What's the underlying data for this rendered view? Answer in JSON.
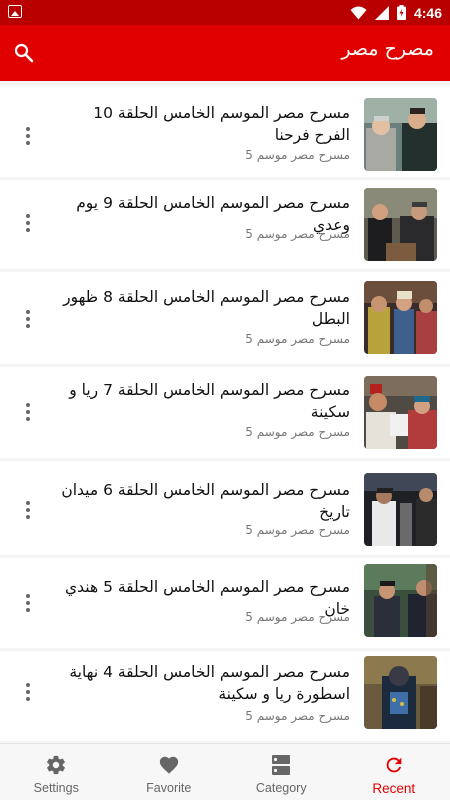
{
  "status_bar": {
    "time": "4:46"
  },
  "app_bar": {
    "title": "مصرح مصر",
    "search_icon": "search-icon"
  },
  "colors": {
    "primary": "#e00000",
    "status_bar": "#b80000",
    "active": "#e00000"
  },
  "episodes": [
    {
      "title": "مسرح مصر الموسم الخامس الحلقة 10 الفرح فرحنا",
      "subtitle": "مسرح مصر موسم 5"
    },
    {
      "title": "مسرح مصر الموسم الخامس الحلقة 9 يوم وعدي",
      "subtitle": "مسرح مصر موسم 5"
    },
    {
      "title": "مسرح مصر الموسم الخامس الحلقة 8 ظهور البطل",
      "subtitle": "مسرح مصر موسم 5"
    },
    {
      "title": "مسرح مصر الموسم الخامس الحلقة 7 ريا و سكينة",
      "subtitle": "مسرح مصر موسم 5"
    },
    {
      "title": "مسرح مصر الموسم الخامس الحلقة 6 ميدان تاريخ",
      "subtitle": "مسرح مصر موسم 5"
    },
    {
      "title": "مسرح مصر الموسم الخامس الحلقة 5 هندي خان",
      "subtitle": "مسرح مصر موسم 5"
    },
    {
      "title": "مسرح مصر الموسم الخامس الحلقة 4 نهاية اسطورة ريا و سكينة",
      "subtitle": "مسرح مصر موسم 5"
    }
  ],
  "bottom_nav": [
    {
      "label": "Settings",
      "icon": "gear-icon"
    },
    {
      "label": "Favorite",
      "icon": "heart-icon"
    },
    {
      "label": "Category",
      "icon": "category-icon"
    },
    {
      "label": "Recent",
      "icon": "refresh-icon",
      "active": true
    }
  ]
}
